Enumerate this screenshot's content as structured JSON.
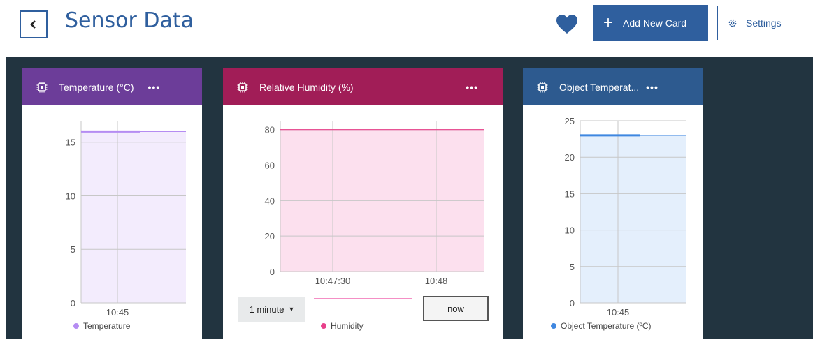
{
  "header": {
    "title": "Sensor Data",
    "add_label": "Add New Card",
    "settings_label": "Settings",
    "accent_color": "#2f5f9e"
  },
  "cards": [
    {
      "title": "Temperature (°C)",
      "menu": "•••",
      "header_color": "#6c3d99",
      "legend": "Temperature",
      "series_color": "#b58cf2",
      "fill_color": "#f3ecfd"
    },
    {
      "title": "Relative Humidity (%)",
      "menu": "•••",
      "header_color": "#a11d57",
      "legend": "Humidity",
      "series_color": "#e8408a",
      "fill_color": "#fce0ee",
      "range_label": "1 minute",
      "now_label": "now"
    },
    {
      "title": "Object Temperat...",
      "menu": "•••",
      "header_color": "#2d5a8f",
      "legend": "Object Temperature (ºC)",
      "series_color": "#3f87e0",
      "fill_color": "#e4effc"
    }
  ],
  "chart_data": [
    {
      "type": "area",
      "x": [
        "10:45"
      ],
      "yticks": [
        0,
        5,
        10,
        15
      ],
      "ylim": [
        0,
        17
      ],
      "series": [
        {
          "name": "Temperature",
          "values": [
            16
          ]
        }
      ]
    },
    {
      "type": "area",
      "x": [
        "10:47:30",
        "10:48"
      ],
      "yticks": [
        0,
        20,
        40,
        60,
        80
      ],
      "ylim": [
        0,
        85
      ],
      "series": [
        {
          "name": "Humidity",
          "values": [
            80
          ]
        }
      ]
    },
    {
      "type": "area",
      "x": [
        "10:45"
      ],
      "yticks": [
        0,
        5,
        10,
        15,
        20,
        25
      ],
      "ylim": [
        0,
        25
      ],
      "series": [
        {
          "name": "Object Temperature (ºC)",
          "values": [
            23
          ]
        }
      ]
    }
  ]
}
